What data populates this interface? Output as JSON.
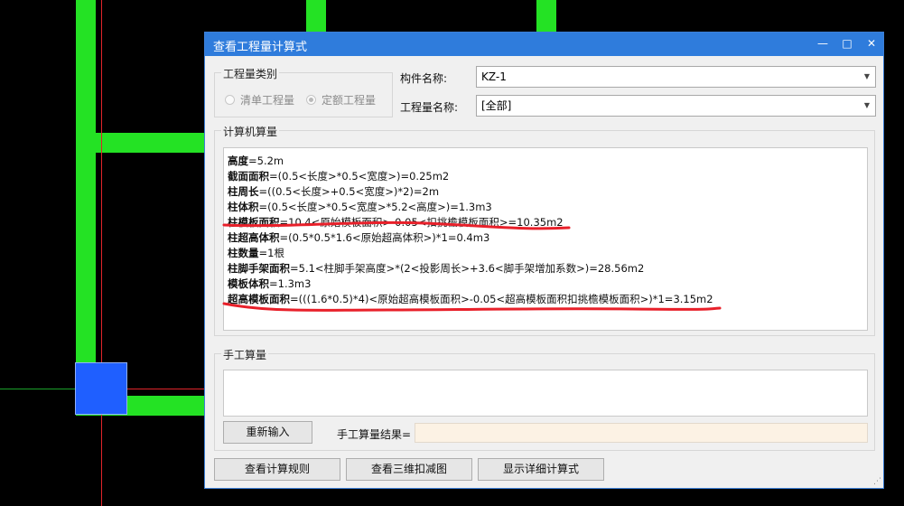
{
  "dialog": {
    "title": "查看工程量计算式",
    "window_buttons": {
      "minimize": "—",
      "maximize": "□",
      "close": "✕"
    }
  },
  "quantity_type": {
    "title": "工程量类别",
    "options": [
      {
        "label": "清单工程量",
        "checked": false
      },
      {
        "label": "定额工程量",
        "checked": true
      }
    ]
  },
  "component": {
    "label": "构件名称:",
    "value": "KZ-1"
  },
  "quantity_name": {
    "label": "工程量名称:",
    "value": "[全部]"
  },
  "computed": {
    "title": "计算机算量",
    "lines": [
      {
        "name": "高度",
        "expr": "=5.2m"
      },
      {
        "name": "截面面积",
        "expr": "=(0.5<长度>*0.5<宽度>)=0.25m2"
      },
      {
        "name": "柱周长",
        "expr": "=((0.5<长度>+0.5<宽度>)*2)=2m"
      },
      {
        "name": "柱体积",
        "expr": "=(0.5<长度>*0.5<宽度>*5.2<高度>)=1.3m3"
      },
      {
        "name": "柱模板面积",
        "expr": "=10.4<原始模板面积>-0.05<扣挑檐模板面积>=10.35m2"
      },
      {
        "name": "柱超高体积",
        "expr": "=(0.5*0.5*1.6<原始超高体积>)*1=0.4m3"
      },
      {
        "name": "柱数量",
        "expr": "=1根"
      },
      {
        "name": "柱脚手架面积",
        "expr": "=5.1<柱脚手架高度>*(2<投影周长>+3.6<脚手架增加系数>)=28.56m2"
      },
      {
        "name": "模板体积",
        "expr": "=1.3m3"
      },
      {
        "name": "超高模板面积",
        "expr": "=(((1.6*0.5)*4)<原始超高模板面积>-0.05<超高模板面积扣挑檐模板面积>)*1=3.15m2"
      }
    ]
  },
  "manual": {
    "title": "手工算量",
    "reenter_button": "重新输入",
    "result_label": "手工算量结果="
  },
  "footer": {
    "rules_button": "查看计算规则",
    "view3d_button": "查看三维扣减图",
    "detail_button": "显示详细计算式"
  },
  "colors": {
    "title_bar": "#2f7cdc",
    "cad_wall": "#24e224",
    "cad_column": "#1f5fff",
    "annotation": "#e8202a"
  },
  "icons": [
    "minimize-icon",
    "maximize-icon",
    "close-icon",
    "dropdown-caret-icon",
    "resize-grip-icon"
  ]
}
